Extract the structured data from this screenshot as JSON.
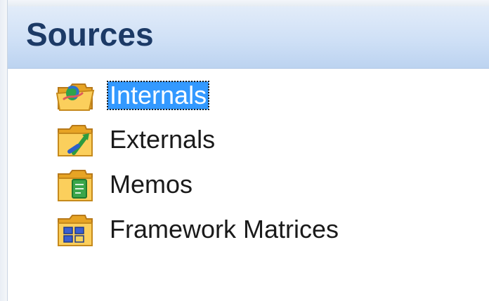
{
  "panel": {
    "title": "Sources"
  },
  "tree": {
    "items": [
      {
        "label": "Internals",
        "icon": "folder-internals-icon",
        "selected": true
      },
      {
        "label": "Externals",
        "icon": "folder-externals-icon",
        "selected": false
      },
      {
        "label": "Memos",
        "icon": "folder-memos-icon",
        "selected": false
      },
      {
        "label": "Framework Matrices",
        "icon": "folder-framework-matrices-icon",
        "selected": false
      }
    ]
  },
  "colors": {
    "selection": "#3399ff",
    "header_text": "#1c3a66",
    "folder": "#f4b233"
  }
}
